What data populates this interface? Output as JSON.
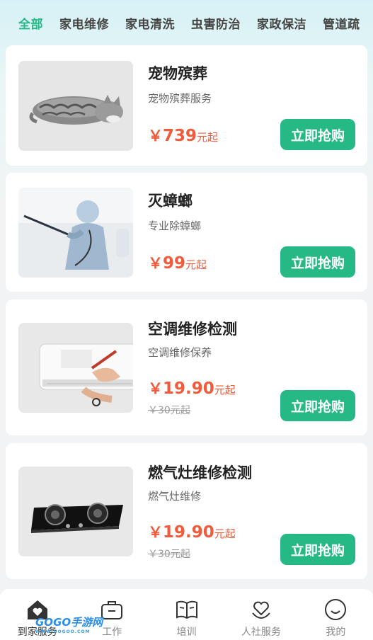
{
  "categories": [
    "全部",
    "家电维修",
    "家电清洗",
    "虫害防治",
    "家政保洁",
    "管道疏"
  ],
  "active_category": "全部",
  "currency": "￥",
  "unit_suffix": "元起",
  "buy_label": "立即抢购",
  "services": [
    {
      "title": "宠物殡葬",
      "subtitle": "宠物殡葬服务",
      "price": "739",
      "original_price": "",
      "image": "sleeping-cat-image"
    },
    {
      "title": "灭蟑螂",
      "subtitle": "专业除蟑螂",
      "price": "99",
      "original_price": "",
      "image": "pest-control-worker-image"
    },
    {
      "title": "空调维修检测",
      "subtitle": "空调维修保养",
      "price": "19.90",
      "original_price": "￥30元起",
      "image": "air-conditioner-repair-image"
    },
    {
      "title": "燃气灶维修检测",
      "subtitle": "燃气灶维修",
      "price": "19.90",
      "original_price": "￥30元起",
      "image": "gas-stove-image"
    }
  ],
  "tabbar": [
    {
      "label": "到家服务",
      "icon": "home-heart-icon",
      "active": true
    },
    {
      "label": "工作",
      "icon": "briefcase-icon",
      "active": false
    },
    {
      "label": "培训",
      "icon": "book-icon",
      "active": false
    },
    {
      "label": "人社服务",
      "icon": "heart-hand-icon",
      "active": false
    },
    {
      "label": "我的",
      "icon": "smile-icon",
      "active": false
    }
  ],
  "watermark": {
    "main": "GOGO手游网",
    "small": "WWW.GOGOO.COM"
  },
  "colors": {
    "accent": "#27b985",
    "price": "#f15a3a",
    "active_tab": "#26b787"
  }
}
